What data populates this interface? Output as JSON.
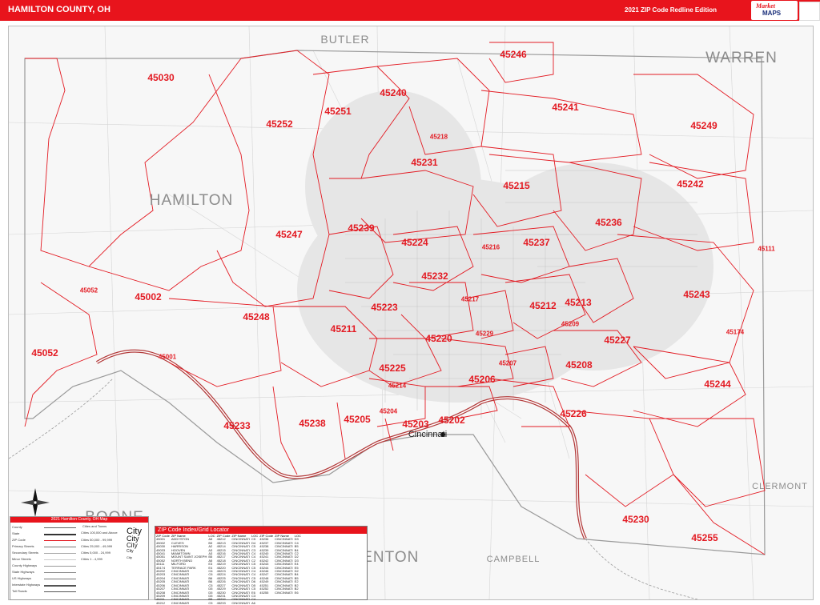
{
  "header": {
    "title": "HAMILTON COUNTY, OH",
    "edition": "2021 ZIP Code Redline Edition",
    "logo_line1": "Market",
    "logo_line2": "MAPS"
  },
  "counties": [
    {
      "name": "BUTLER",
      "cls": "l"
    },
    {
      "name": "WARREN",
      "cls": "xl"
    },
    {
      "name": "HAMILTON",
      "cls": "xl"
    },
    {
      "name": "CLERMONT",
      "cls": "m"
    },
    {
      "name": "BOONE",
      "cls": "xl"
    },
    {
      "name": "CAMPBELL",
      "cls": "m"
    },
    {
      "name": "KENTON",
      "cls": "xl"
    }
  ],
  "city_label": "Cincinnati",
  "zips": [
    "45246",
    "45030",
    "45251",
    "45240",
    "45241",
    "45249",
    "45252",
    "45218",
    "45231",
    "45215",
    "45242",
    "45236",
    "45239",
    "45247",
    "45224",
    "45216",
    "45237",
    "45111",
    "45232",
    "45002",
    "45217",
    "45212",
    "45213",
    "45243",
    "45223",
    "45248",
    "45211",
    "45229",
    "45209",
    "45174",
    "45052",
    "45220",
    "45227",
    "45207",
    "45208",
    "45225",
    "45214",
    "45206",
    "45244",
    "45204",
    "45233",
    "45238",
    "45205",
    "45203",
    "45202",
    "45226",
    "45230",
    "45255",
    "45052",
    "45001"
  ],
  "legend": {
    "title": "2021 Hamilton County, OH Map",
    "cities_header": "Cities and Towns",
    "rows": [
      "County",
      "State",
      "ZIP Code",
      "Primary Streets",
      "Secondary Streets",
      "Minor Streets",
      "County Highways",
      "State Highways",
      "US Highways",
      "Interstate Highways",
      "Toll Roads"
    ],
    "city_rows": [
      "Cities 100,000 and Above",
      "Cities 50,000 - 99,999",
      "Cities 25,000 - 49,999",
      "Cities 5,000 - 24,999",
      "Cities 1 - 4,999"
    ],
    "sample_city": "City"
  },
  "index": {
    "title": "ZIP Code Index/Grid Locator",
    "columns": [
      "ZIP Code",
      "ZIP Name",
      "LOC"
    ],
    "rows": [
      [
        "45001",
        "ADDYSTON",
        "A5",
        "45212",
        "CINCINNATI",
        "C5",
        "45236",
        "CINCINNATI",
        "D3"
      ],
      [
        "45002",
        "CLEVES",
        "B3",
        "45213",
        "CINCINNATI",
        "D4",
        "45237",
        "CINCINNATI",
        "C4"
      ],
      [
        "45030",
        "HARRISON",
        "A2",
        "45214",
        "CINCINNATI",
        "C5",
        "45238",
        "CINCINNATI",
        "B5"
      ],
      [
        "45033",
        "HOOVEN",
        "A3",
        "45215",
        "CINCINNATI",
        "C3",
        "45239",
        "CINCINNATI",
        "B4"
      ],
      [
        "45041",
        "MIAMITOWN",
        "A3",
        "45216",
        "CINCINNATI",
        "C4",
        "45240",
        "CINCINNATI",
        "C2"
      ],
      [
        "45051",
        "MOUNT SAINT JOSEPH",
        "B5",
        "45217",
        "CINCINNATI",
        "C4",
        "45241",
        "CINCINNATI",
        "D2"
      ],
      [
        "45052",
        "NORTH BEND",
        "A5",
        "45218",
        "CINCINNATI",
        "C2",
        "45242",
        "CINCINNATI",
        "D3"
      ],
      [
        "45111",
        "MILFORD",
        "E3",
        "45219",
        "CINCINNATI",
        "C5",
        "45243",
        "CINCINNATI",
        "E4"
      ],
      [
        "45174",
        "TERRACE PARK",
        "E4",
        "45220",
        "CINCINNATI",
        "C5",
        "45244",
        "CINCINNATI",
        "E5"
      ],
      [
        "45202",
        "CINCINNATI",
        "C6",
        "45223",
        "CINCINNATI",
        "C4",
        "45246",
        "CINCINNATI",
        "D2"
      ],
      [
        "45203",
        "CINCINNATI",
        "C6",
        "45224",
        "CINCINNATI",
        "C4",
        "45247",
        "CINCINNATI",
        "B4"
      ],
      [
        "45204",
        "CINCINNATI",
        "B6",
        "45225",
        "CINCINNATI",
        "C5",
        "45248",
        "CINCINNATI",
        "B5"
      ],
      [
        "45205",
        "CINCINNATI",
        "B6",
        "45226",
        "CINCINNATI",
        "D6",
        "45249",
        "CINCINNATI",
        "E2"
      ],
      [
        "45206",
        "CINCINNATI",
        "C5",
        "45227",
        "CINCINNATI",
        "D5",
        "45251",
        "CINCINNATI",
        "B2"
      ],
      [
        "45207",
        "CINCINNATI",
        "D5",
        "45229",
        "CINCINNATI",
        "C5",
        "45252",
        "CINCINNATI",
        "B2"
      ],
      [
        "45208",
        "CINCINNATI",
        "D5",
        "45230",
        "CINCINNATI",
        "E6",
        "45255",
        "CINCINNATI",
        "E6"
      ],
      [
        "45209",
        "CINCINNATI",
        "D5",
        "45231",
        "CINCINNATI",
        "C3",
        "",
        "",
        ""
      ],
      [
        "45211",
        "CINCINNATI",
        "B5",
        "45232",
        "CINCINNATI",
        "C4",
        "",
        "",
        ""
      ],
      [
        "45212",
        "CINCINNATI",
        "C5",
        "45233",
        "CINCINNATI",
        "A6",
        "",
        "",
        ""
      ]
    ]
  },
  "colors": {
    "header": "#e8141c",
    "zip_label": "#e31b23",
    "zip_boundary": "#e31b23",
    "river": "#b23a3a",
    "county_label": "#8c8c8c"
  },
  "icons": [
    "compass-rose-icon",
    "market-maps-logo-icon"
  ]
}
